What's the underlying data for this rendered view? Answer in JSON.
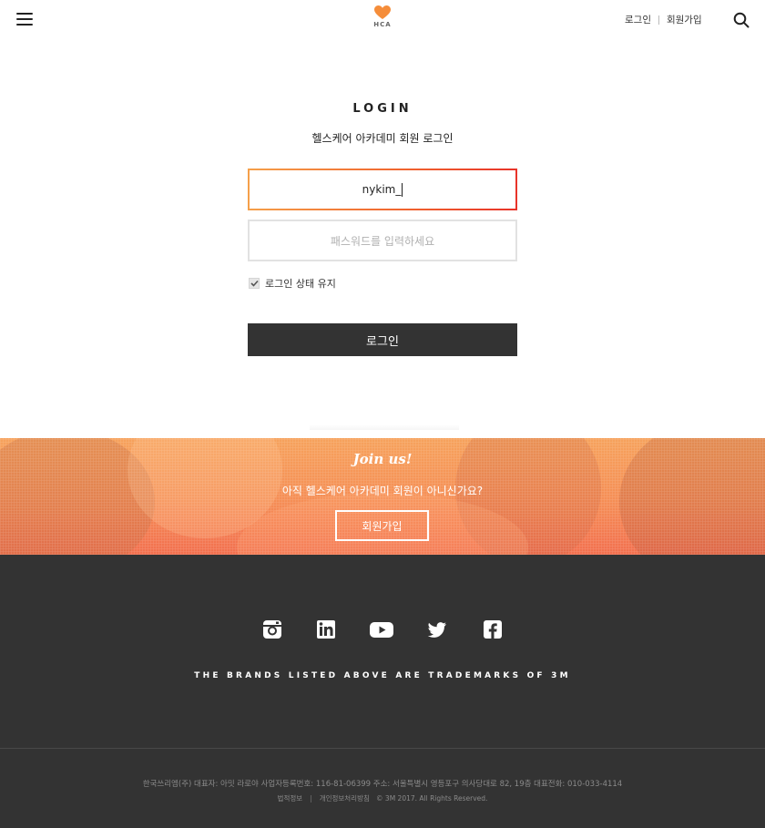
{
  "header": {
    "logo_text": "HCA",
    "login_link": "로그인",
    "signup_link": "회원가입"
  },
  "login": {
    "title": "LOGIN",
    "subtitle": "헬스케어 아카데미 회원 로그인",
    "id_value": "nykim_",
    "password_placeholder": "패스워드를 입력하세요",
    "remember_label": "로그인 상태 유지",
    "remember_checked": true,
    "button_label": "로그인"
  },
  "join": {
    "script_title": "Join us!",
    "text": "아직 헬스케어 아카데미 회원이 아니신가요?",
    "button_label": "회원가입"
  },
  "footer": {
    "social_icons": [
      "instagram-icon",
      "linkedin-icon",
      "youtube-icon",
      "twitter-icon",
      "facebook-icon"
    ],
    "trademark": "THE BRANDS LISTED ABOVE ARE TRADEMARKS OF 3M",
    "company_info": "한국쓰리엠(주) 대표자: 아밋 라로야 사업자등록번호: 116-81-06399 주소: 서울특별시 영등포구 의사당대로 82, 19층 대표전화: 010-033-4114",
    "legal_link": "법적정보",
    "privacy_link": "개인정보처리방침",
    "copyright": "© 3M 2017. All Rights Reserved."
  },
  "colors": {
    "accent_orange": "#f58d55",
    "accent_red": "#e8332a",
    "dark": "#333333"
  }
}
